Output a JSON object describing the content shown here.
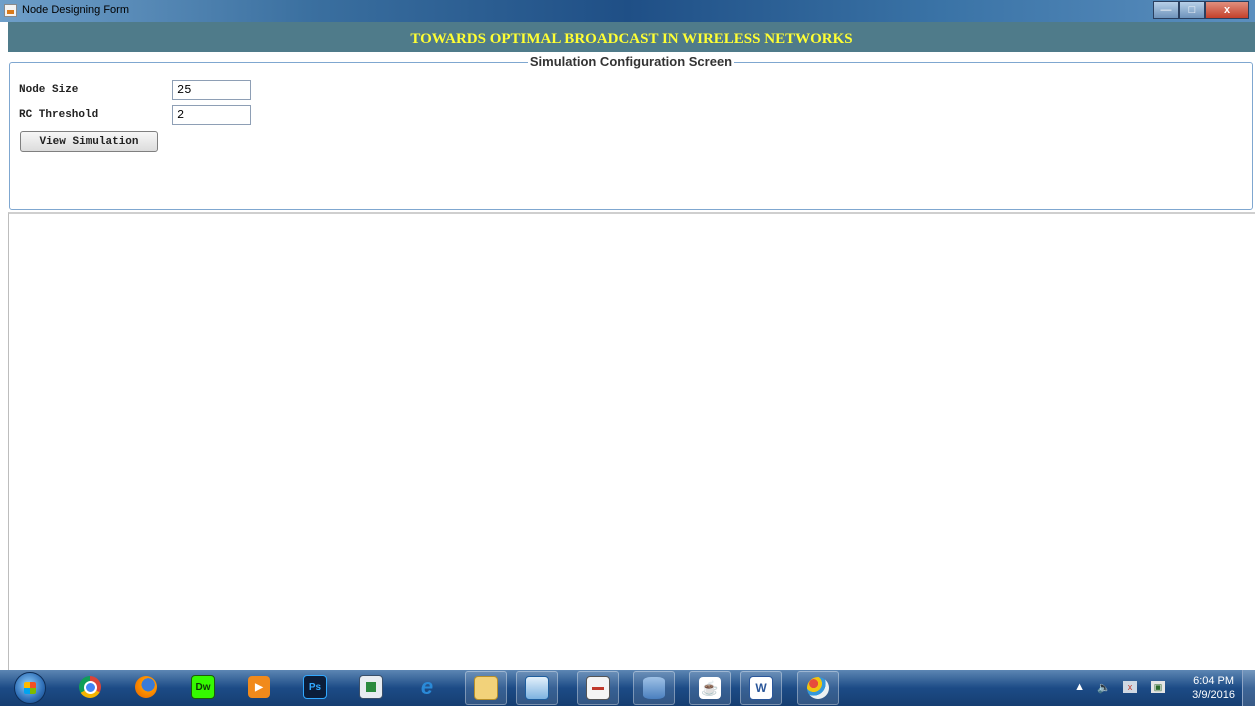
{
  "window": {
    "title": "Node Designing Form",
    "controls": {
      "minimize": "—",
      "maximize": "□",
      "close": "x"
    }
  },
  "banner": {
    "heading": "TOWARDS OPTIMAL BROADCAST IN WIRELESS NETWORKS"
  },
  "config": {
    "legend": "Simulation Configuration Screen",
    "node_size": {
      "label": "Node Size",
      "value": "25"
    },
    "rc_threshold": {
      "label": "RC Threshold",
      "value": "2"
    },
    "view_button": "View Simulation"
  },
  "taskbar": {
    "apps": [
      {
        "name": "chrome-icon"
      },
      {
        "name": "firefox-icon"
      },
      {
        "name": "dreamweaver-icon",
        "label": "Dw"
      },
      {
        "name": "media-player-icon"
      },
      {
        "name": "photoshop-icon",
        "label": "Ps"
      },
      {
        "name": "window-app-icon"
      },
      {
        "name": "internet-explorer-icon",
        "label": "e"
      },
      {
        "name": "file-explorer-icon"
      },
      {
        "name": "virtualbox-icon"
      },
      {
        "name": "notepad-icon"
      },
      {
        "name": "database-icon"
      },
      {
        "name": "java-icon"
      },
      {
        "name": "word-icon",
        "label": "W"
      },
      {
        "name": "paint-icon"
      }
    ],
    "tray": {
      "time": "6:04 PM",
      "date": "3/9/2016"
    }
  }
}
